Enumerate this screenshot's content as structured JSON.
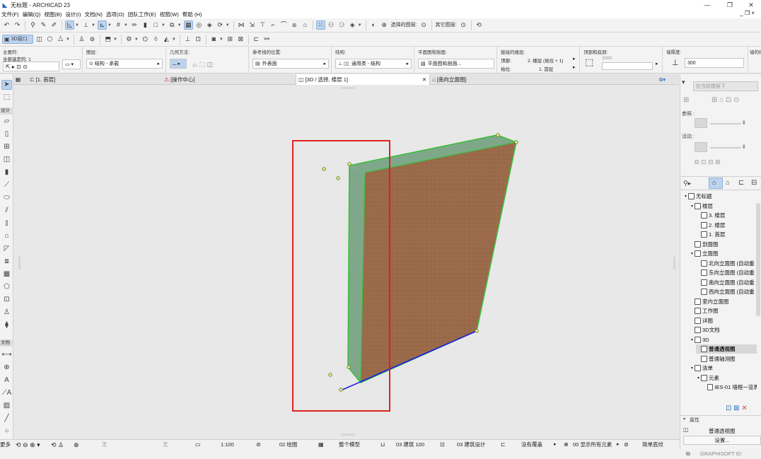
{
  "window": {
    "title": "无标题 - ARCHICAD 23",
    "controls": {
      "minimize": "—",
      "restore": "❐",
      "close": "✕"
    },
    "secondary_controls": "_ ❐ ×"
  },
  "menu": [
    "文件(F)",
    "编辑(Q)",
    "视图(B)",
    "设计(I)",
    "文档(N)",
    "选项(O)",
    "团队工作(E)",
    "视窗(W)",
    "帮助 (H)"
  ],
  "toolbar": {
    "layer_selected_label": "选择的图层:",
    "other_layers_label": "其它图层:",
    "window_3d_label": "3D窗口"
  },
  "infobox": {
    "main_label": "主要的:",
    "all_selected": "全部选定的: 1",
    "layer_label": "图层:",
    "layer_value": "结构 - 承载",
    "geometry_label": "几何方法:",
    "ref_line_label": "参考线的位置:",
    "ref_line_value": "外表面",
    "structure_label": "结构:",
    "structure_value": "通用类 - 结构",
    "plan_section_label": "平面图和剖面:",
    "plan_section_value": "平面图和剖面...",
    "linked_floor_label": "链接的楼层:",
    "top_label": "顶部:",
    "top_value": "2. 楼层 (始位 + 1)",
    "start_label": "始位:",
    "start_value": "1. 首层",
    "top_bottom_label": "顶部和底部:",
    "top_bottom_value": "3000",
    "wall_thickness_label": "墙厚度:",
    "wall_thickness_value": "300",
    "wall_extra_label": "墙的结"
  },
  "tabs": [
    {
      "label": "[1. 首层]",
      "active": false
    },
    {
      "label": "[操作中心]",
      "active": false
    },
    {
      "label": "[3D / 选择, 楼层 1]",
      "active": true
    },
    {
      "label": "[南向立面图]",
      "active": false
    }
  ],
  "toolbox": {
    "section_design": "设计",
    "section_document": "文档",
    "section_more": "更多"
  },
  "right_panel": {
    "floor_placeholder": "在当前楼层下",
    "ref_label": "参照 :",
    "active_label": "活动 :",
    "tree": [
      {
        "label": "无标题",
        "level": 0,
        "toggle": "v"
      },
      {
        "label": "楼层",
        "level": 1,
        "toggle": "v"
      },
      {
        "label": "3. 楼层",
        "level": 2,
        "toggle": ""
      },
      {
        "label": "2. 楼层",
        "level": 2,
        "toggle": ""
      },
      {
        "label": "1. 首层",
        "level": 2,
        "toggle": ""
      },
      {
        "label": "剖面图",
        "level": 1,
        "toggle": ""
      },
      {
        "label": "立面图",
        "level": 1,
        "toggle": "v"
      },
      {
        "label": "北向立面图 (自动重",
        "level": 2,
        "toggle": ""
      },
      {
        "label": "东向立面图 (自动重",
        "level": 2,
        "toggle": ""
      },
      {
        "label": "南向立面图 (自动重",
        "level": 2,
        "toggle": ""
      },
      {
        "label": "西向立面图 (自动重",
        "level": 2,
        "toggle": ""
      },
      {
        "label": "室内立面图",
        "level": 1,
        "toggle": ""
      },
      {
        "label": "工作图",
        "level": 1,
        "toggle": ""
      },
      {
        "label": "详图",
        "level": 1,
        "toggle": ""
      },
      {
        "label": "3D文档",
        "level": 1,
        "toggle": ""
      },
      {
        "label": "3D",
        "level": 1,
        "toggle": "v"
      },
      {
        "label": "普通透视图",
        "level": 2,
        "toggle": "",
        "selected": true
      },
      {
        "label": "普通轴测图",
        "level": 2,
        "toggle": ""
      },
      {
        "label": "清单",
        "level": 1,
        "toggle": "v"
      },
      {
        "label": "元素",
        "level": 2,
        "toggle": "v"
      },
      {
        "label": "IES-01 墙框一览表",
        "level": 3,
        "toggle": ""
      }
    ],
    "properties_header": "属性",
    "properties_value": "普通透视图",
    "settings_button": "设置..."
  },
  "statusbar": {
    "none1": "无",
    "none2": "无",
    "scale": "1:100",
    "pen_set": "02 绘图",
    "model_view": "整个模型",
    "layer_combo": "03 建筑 100",
    "dimension": "03 建筑设计",
    "override": "没有覆盖",
    "renovation": "00 显示所有元素",
    "structure_display": "简单底纹"
  },
  "brand": "GRAPHISOFT ID",
  "colors": {
    "wall_fill": "#9a6a4a",
    "wall_edge": "#3cbf3c",
    "wall_side": "#7fa88a",
    "baseline": "#1a1aee",
    "selection_rect": "#e02020"
  }
}
